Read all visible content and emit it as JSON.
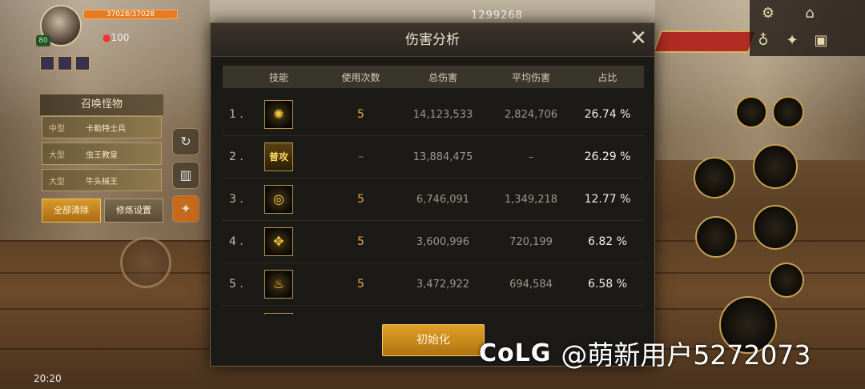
{
  "hud": {
    "hp_text": "37028/37028",
    "mp_text": "100",
    "level": "80",
    "gold": "1299268",
    "timer": "20:20"
  },
  "summon_panel": {
    "title": "召唤怪物",
    "rows": [
      {
        "size": "中型",
        "name": "卡勒特士兵"
      },
      {
        "size": "大型",
        "name": "虫王教皇"
      },
      {
        "size": "大型",
        "name": "牛头械王"
      }
    ],
    "clear_all_label": "全部清除",
    "training_settings_label": "修炼设置"
  },
  "dialog": {
    "title": "伤害分析",
    "close_symbol": "✕",
    "headers": {
      "skill": "技能",
      "count": "使用次数",
      "total": "总伤害",
      "avg": "平均伤害",
      "pct": "占比"
    },
    "rows": [
      {
        "rank": "1 .",
        "icon": "vitruvian-skill-icon",
        "icon_glyph": "✺",
        "count": "5",
        "total": "14,123,533",
        "avg": "2,824,706",
        "pct": "26.74 %"
      },
      {
        "rank": "2 .",
        "icon": "basic-attack-icon",
        "icon_text": "普攻",
        "count": "–",
        "total": "13,884,475",
        "avg": "–",
        "pct": "26.29 %"
      },
      {
        "rank": "3 .",
        "icon": "whirlwind-skill-icon",
        "icon_glyph": "◎",
        "count": "5",
        "total": "6,746,091",
        "avg": "1,349,218",
        "pct": "12.77 %"
      },
      {
        "rank": "4 .",
        "icon": "cross-light-skill-icon",
        "icon_glyph": "✥",
        "count": "5",
        "total": "3,600,996",
        "avg": "720,199",
        "pct": "6.82 %"
      },
      {
        "rank": "5 .",
        "icon": "flame-skill-icon",
        "icon_glyph": "♨",
        "count": "5",
        "total": "3,472,922",
        "avg": "694,584",
        "pct": "6.58 %"
      }
    ],
    "reset_label": "初始化"
  },
  "watermark": {
    "logo": "CoLG",
    "user": "@萌新用户5272073"
  }
}
